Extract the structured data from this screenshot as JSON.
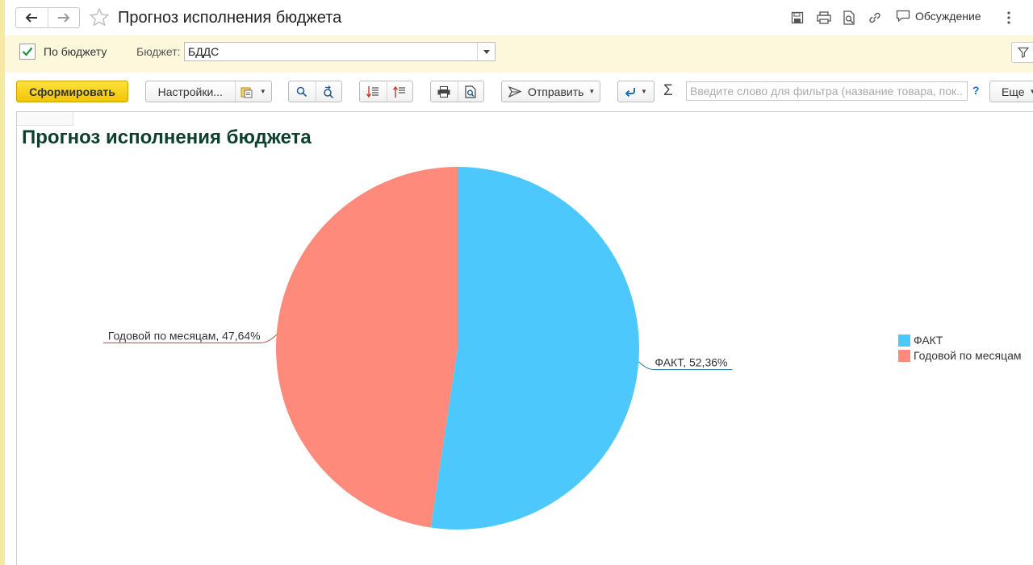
{
  "window": {
    "title": "Прогноз исполнения бюджета",
    "discussion_label": "Обсуждение"
  },
  "filters": {
    "by_budget_label": "По бюджету",
    "by_budget_checked": true,
    "budget_label": "Бюджет:",
    "budget_value": "БДДС"
  },
  "toolbar": {
    "generate_label": "Сформировать",
    "settings_label": "Настройки...",
    "send_label": "Отправить",
    "search_placeholder": "Введите слово для фильтра (название товара, пок...",
    "help_label": "?",
    "more_label": "Еще"
  },
  "report": {
    "title": "Прогноз исполнения бюджета"
  },
  "colors": {
    "fact": "#4dc8fc",
    "plan": "#fd8a7a",
    "accent": "#f2c500"
  },
  "chart_data": {
    "type": "pie",
    "title": "Прогноз исполнения бюджета",
    "legend_position": "right",
    "slices": [
      {
        "name": "ФАКТ",
        "value": 52.36,
        "label": "ФАКТ, 52,36%",
        "color": "#4dc8fc"
      },
      {
        "name": "Годовой по месяцам",
        "value": 47.64,
        "label": "Годовой по месяцам, 47,64%",
        "color": "#fd8a7a"
      }
    ]
  }
}
